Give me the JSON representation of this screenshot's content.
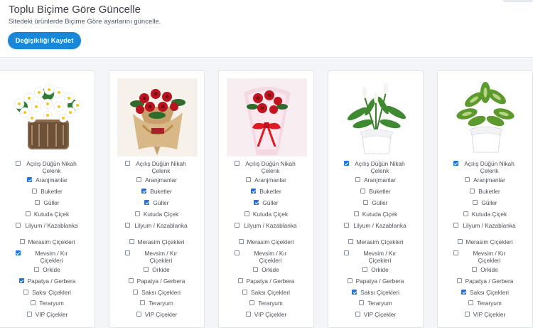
{
  "page": {
    "title": "Toplu Biçime Göre Güncelle",
    "subtitle": "Sitedeki ürünlerde Biçime Göre ayarlarını güncelle.",
    "save_label": "Değişikliği Kaydet"
  },
  "colors": {
    "accent": "#1887d8",
    "checkbox": "#1a73e8"
  },
  "categories": [
    "Açılış Düğün Nikah Çelenk",
    "Aranjmanlar",
    "Buketler",
    "Güller",
    "Kutuda Çiçek",
    "Lilyum / Kazablanka",
    "Merasim Çiçekleri",
    "Mevsim / Kır Çiçekleri",
    "Orkide",
    "Papatya / Gerbera",
    "Saksı Çiçekleri",
    "Teraryum",
    "VIP Çiçekler"
  ],
  "cards": [
    {
      "image": "daisy-arrangement-in-log",
      "checked": [
        false,
        true,
        false,
        false,
        false,
        false,
        false,
        true,
        false,
        true,
        false,
        false,
        false
      ]
    },
    {
      "image": "red-roses-burlap-bouquet",
      "checked": [
        false,
        false,
        true,
        true,
        false,
        false,
        false,
        false,
        false,
        false,
        false,
        false,
        false
      ]
    },
    {
      "image": "red-roses-cellophane-bouquet",
      "checked": [
        false,
        false,
        true,
        true,
        false,
        false,
        false,
        false,
        false,
        false,
        false,
        false,
        false
      ]
    },
    {
      "image": "peace-lily-white-pot",
      "checked": [
        true,
        false,
        false,
        false,
        false,
        false,
        false,
        false,
        false,
        false,
        true,
        false,
        false
      ]
    },
    {
      "image": "dieffenbachia-white-pot",
      "checked": [
        true,
        false,
        false,
        false,
        false,
        false,
        false,
        false,
        false,
        false,
        true,
        false,
        false
      ]
    }
  ]
}
